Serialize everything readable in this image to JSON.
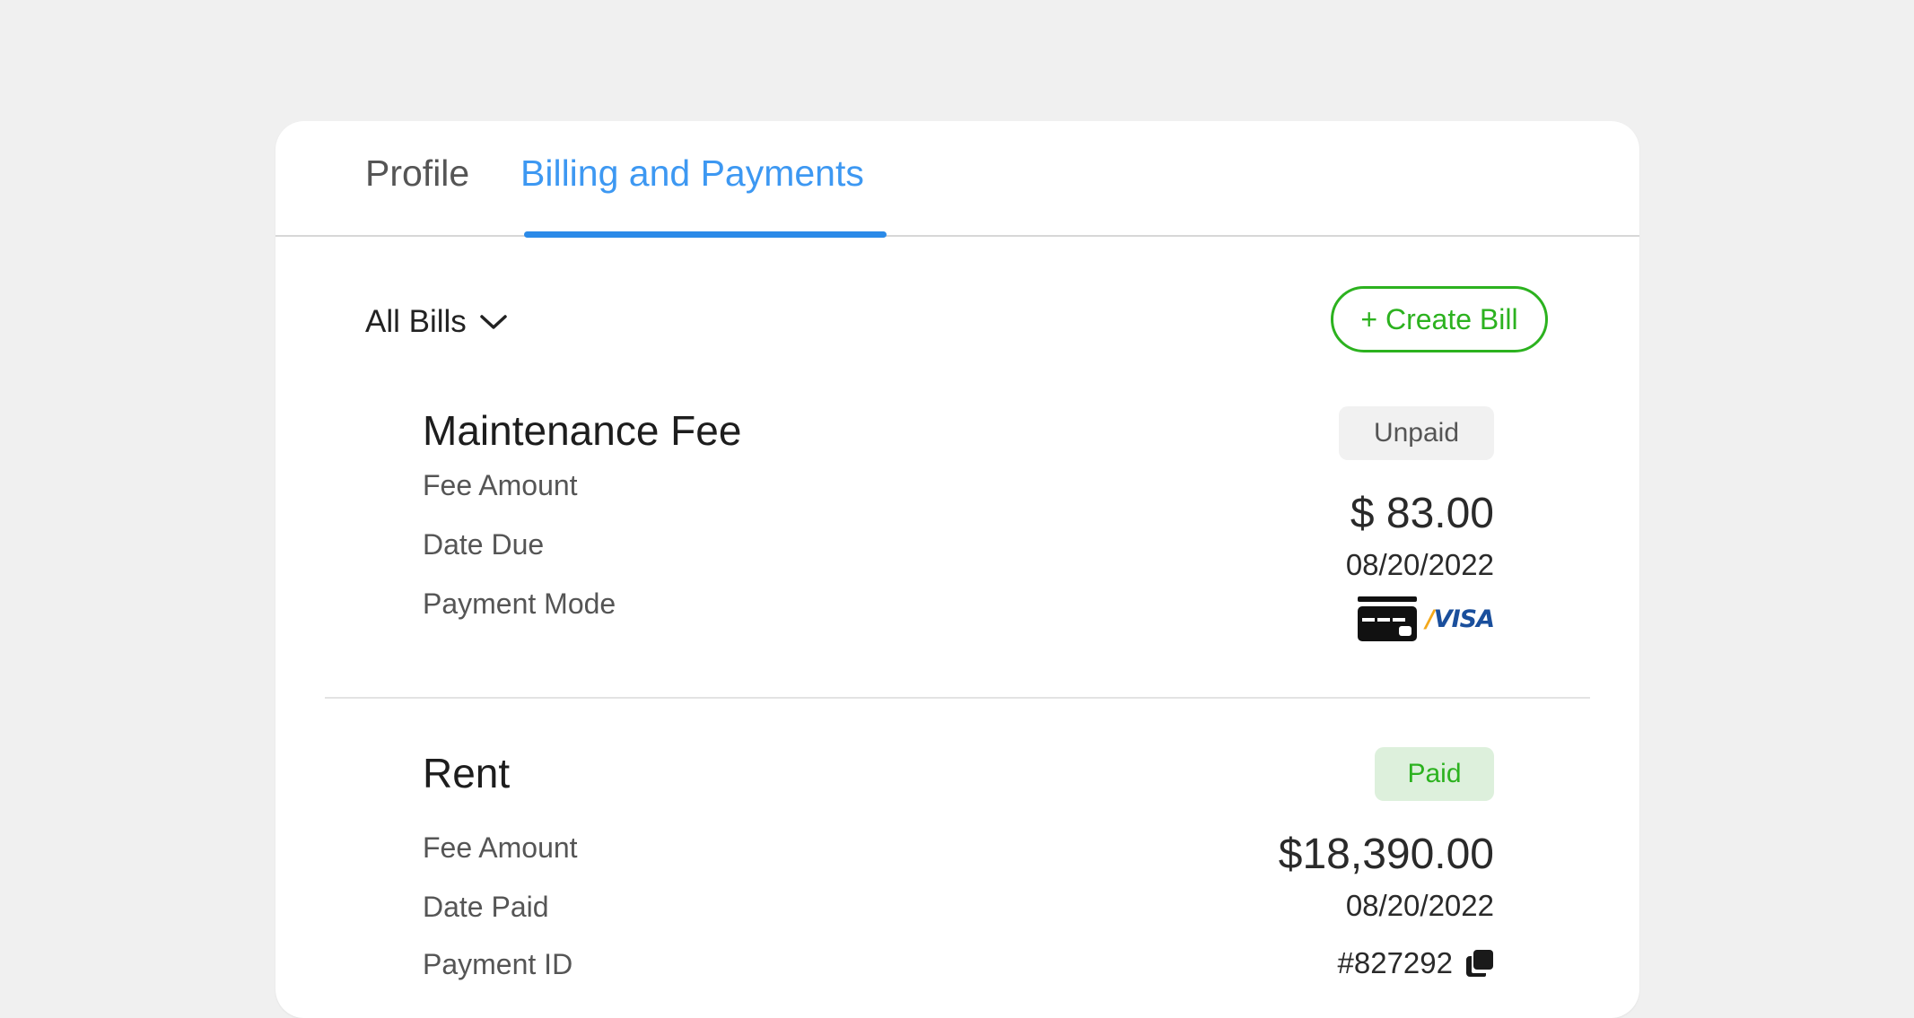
{
  "tabs": [
    {
      "label": "Profile",
      "active": false
    },
    {
      "label": "Billing and Payments",
      "active": true
    }
  ],
  "filter": {
    "label": "All Bills",
    "icon": "chevron-down-icon"
  },
  "create_bill": {
    "label": "+ Create Bill"
  },
  "bills": [
    {
      "title": "Maintenance Fee",
      "status": "Unpaid",
      "fields": [
        {
          "label": "Fee Amount",
          "value": "$ 83.00"
        },
        {
          "label": "Date Due",
          "value": "08/20/2022"
        },
        {
          "label": "Payment Mode",
          "value": "VISA",
          "icon": "credit-card-icon"
        }
      ]
    },
    {
      "title": "Rent",
      "status": "Paid",
      "fields": [
        {
          "label": "Fee Amount",
          "value": "$18,390.00"
        },
        {
          "label": "Date Paid",
          "value": "08/20/2022"
        },
        {
          "label": "Payment ID",
          "value": "#827292",
          "icon": "copy-icon"
        }
      ]
    }
  ],
  "colors": {
    "accent_blue": "#3d98f2",
    "accent_green": "#2cb21f",
    "paid_badge_bg": "#ddf0dc",
    "unpaid_badge_bg": "#f1f1f1",
    "page_bg": "#f0f0f0"
  }
}
